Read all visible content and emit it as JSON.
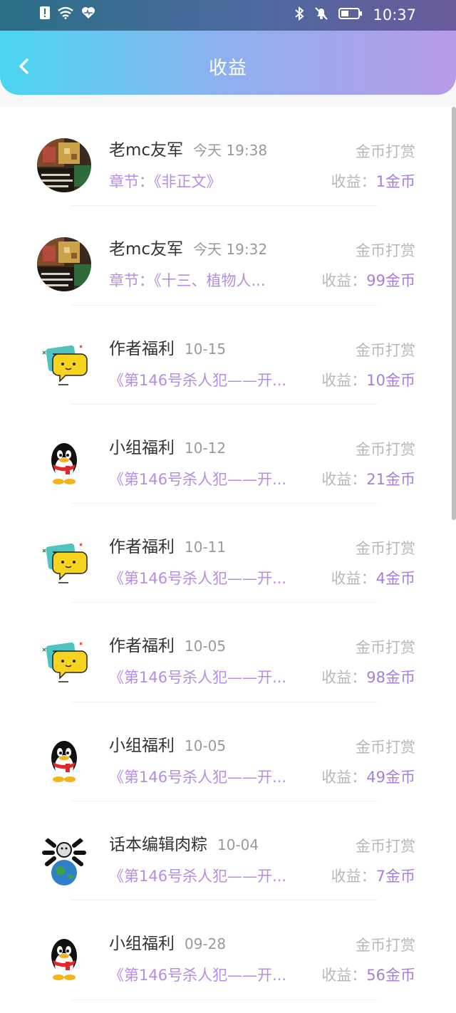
{
  "status_bar": {
    "time": "10:37",
    "icons": [
      "alert-icon",
      "wifi-icon",
      "heart-icon",
      "bluetooth-icon",
      "bell-muted-icon",
      "battery-icon"
    ]
  },
  "header": {
    "title": "收益",
    "back_icon": "chevron-left-icon"
  },
  "colors": {
    "header_gradient": [
      "#4ad6f2",
      "#8fb0f0",
      "#b79be8"
    ],
    "accent_purple": "#a77fd9",
    "muted_text": "#b8b8b8"
  },
  "earnings": [
    {
      "name": "老mc友军",
      "time": "今天 19:38",
      "type": "金币打赏",
      "desc": "章节：《非正文》",
      "earn_label": "收益：",
      "earn_value": "1金币",
      "avatar": "photo-avatar"
    },
    {
      "name": "老mc友军",
      "time": "今天 19:32",
      "type": "金币打赏",
      "desc": "章节：《十三、植物人...",
      "earn_label": "收益：",
      "earn_value": "99金币",
      "avatar": "photo-avatar"
    },
    {
      "name": "作者福利",
      "time": "10-15",
      "type": "金币打赏",
      "desc": "《第146号杀人犯——开...",
      "earn_label": "收益：",
      "earn_value": "10金币",
      "avatar": "chat-bubble-avatar"
    },
    {
      "name": "小组福利",
      "time": "10-12",
      "type": "金币打赏",
      "desc": "《第146号杀人犯——开...",
      "earn_label": "收益：",
      "earn_value": "21金币",
      "avatar": "penguin-avatar"
    },
    {
      "name": "作者福利",
      "time": "10-11",
      "type": "金币打赏",
      "desc": "《第146号杀人犯——开...",
      "earn_label": "收益：",
      "earn_value": "4金币",
      "avatar": "chat-bubble-avatar"
    },
    {
      "name": "作者福利",
      "time": "10-05",
      "type": "金币打赏",
      "desc": "《第146号杀人犯——开...",
      "earn_label": "收益：",
      "earn_value": "98金币",
      "avatar": "chat-bubble-avatar"
    },
    {
      "name": "小组福利",
      "time": "10-05",
      "type": "金币打赏",
      "desc": "《第146号杀人犯——开...",
      "earn_label": "收益：",
      "earn_value": "49金币",
      "avatar": "penguin-avatar"
    },
    {
      "name": "话本编辑肉粽",
      "time": "10-04",
      "type": "金币打赏",
      "desc": "《第146号杀人犯——开...",
      "earn_label": "收益：",
      "earn_value": "7金币",
      "avatar": "globe-avatar"
    },
    {
      "name": "小组福利",
      "time": "09-28",
      "type": "金币打赏",
      "desc": "《第146号杀人犯——开...",
      "earn_label": "收益：",
      "earn_value": "56金币",
      "avatar": "penguin-avatar"
    }
  ]
}
